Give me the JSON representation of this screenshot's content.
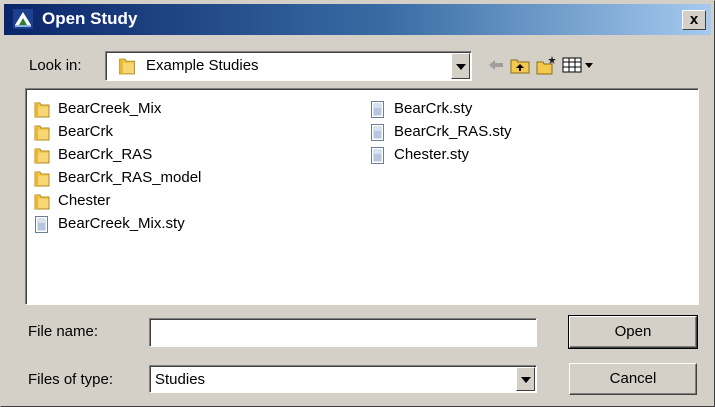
{
  "window": {
    "title": "Open Study",
    "close_label": "x"
  },
  "lookin": {
    "label": "Look in:",
    "value": "Example Studies",
    "icon": "folder-icon"
  },
  "toolbar": {
    "back_icon": "back-arrow-icon",
    "up_icon": "up-folder-icon",
    "new_folder_icon": "new-folder-icon",
    "view_menu_icon": "view-menu-icon"
  },
  "files": {
    "column1": [
      {
        "name": "BearCreek_Mix",
        "type": "folder"
      },
      {
        "name": "BearCrk",
        "type": "folder"
      },
      {
        "name": "BearCrk_RAS",
        "type": "folder"
      },
      {
        "name": "BearCrk_RAS_model",
        "type": "folder"
      },
      {
        "name": "Chester",
        "type": "folder"
      },
      {
        "name": "BearCreek_Mix.sty",
        "type": "file"
      }
    ],
    "column2": [
      {
        "name": "BearCrk.sty",
        "type": "file"
      },
      {
        "name": "BearCrk_RAS.sty",
        "type": "file"
      },
      {
        "name": "Chester.sty",
        "type": "file"
      }
    ]
  },
  "filename": {
    "label": "File name:",
    "value": ""
  },
  "filetype": {
    "label": "Files of type:",
    "value": "Studies"
  },
  "buttons": {
    "open": "Open",
    "cancel": "Cancel"
  },
  "colors": {
    "title_start": "#0a246a",
    "title_end": "#a6caf0",
    "face": "#d4d0c8",
    "folder": "#f2c94c"
  }
}
